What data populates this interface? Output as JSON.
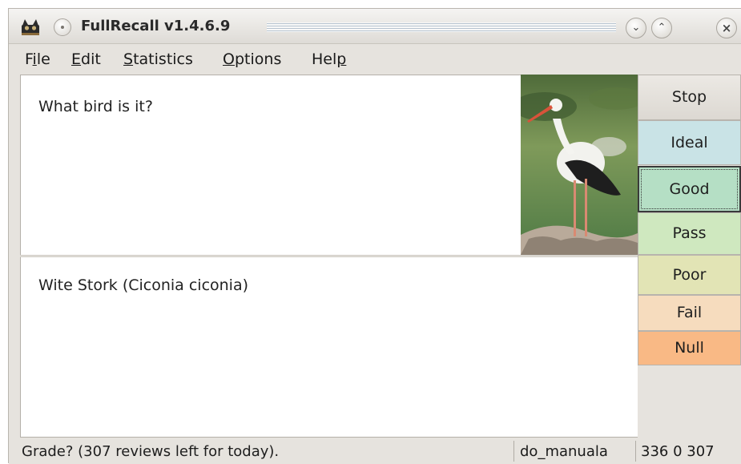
{
  "window": {
    "title": "FullRecall v1.4.6.9"
  },
  "menu": [
    {
      "label": "File"
    },
    {
      "label": "Edit"
    },
    {
      "label": "Statistics"
    },
    {
      "label": "Options"
    },
    {
      "label": "Help"
    }
  ],
  "card": {
    "question": "What bird is it?",
    "answer": "Wite Stork (Ciconia ciconia)"
  },
  "grades": {
    "stop": "Stop",
    "ideal": "Ideal",
    "good": "Good",
    "pass": "Pass",
    "poor": "Poor",
    "fail": "Fail",
    "null": "Null"
  },
  "status": {
    "message": "Grade? (307 reviews left for today).",
    "user": "do_manuala",
    "counts": "336  0  307"
  },
  "colors": {
    "ideal": "#c9e3e6",
    "good": "#b5dfc5",
    "pass": "#cfe8bf",
    "poor": "#e2e4b5",
    "fail": "#f6dcbe",
    "null": "#f9b985"
  }
}
